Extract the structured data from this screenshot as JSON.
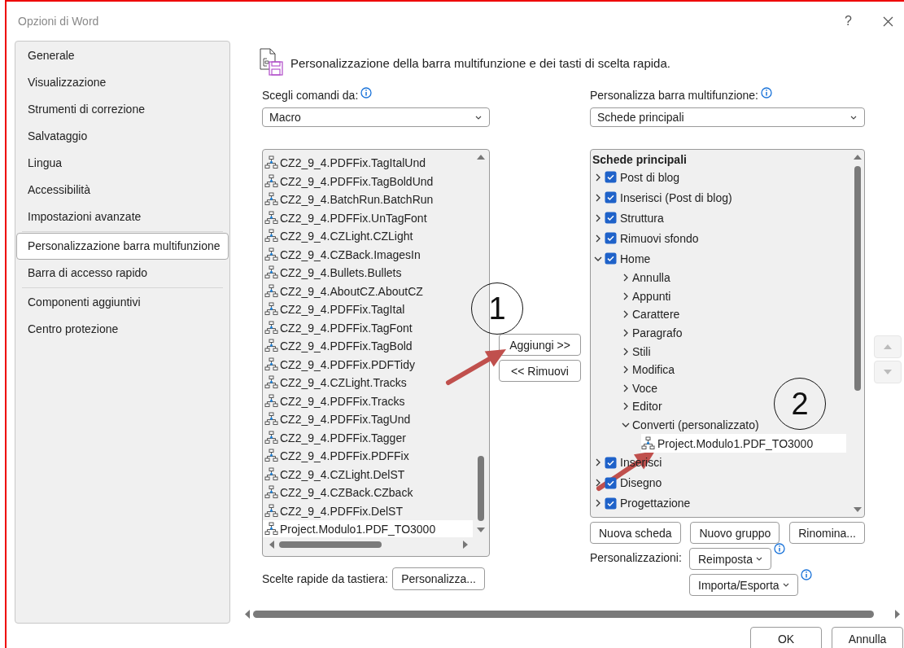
{
  "window": {
    "title": "Opzioni di Word",
    "help": "?"
  },
  "sidebar": {
    "groups": [
      [
        {
          "label": "Generale",
          "selected": false
        },
        {
          "label": "Visualizzazione",
          "selected": false
        },
        {
          "label": "Strumenti di correzione",
          "selected": false
        },
        {
          "label": "Salvataggio",
          "selected": false
        },
        {
          "label": "Lingua",
          "selected": false
        },
        {
          "label": "Accessibilità",
          "selected": false
        },
        {
          "label": "Impostazioni avanzate",
          "selected": false
        }
      ],
      [
        {
          "label": "Personalizzazione barra multifunzione",
          "selected": true
        },
        {
          "label": "Barra di accesso rapido",
          "selected": false
        }
      ],
      [
        {
          "label": "Componenti aggiuntivi",
          "selected": false
        },
        {
          "label": "Centro protezione",
          "selected": false
        }
      ]
    ]
  },
  "page_title": "Personalizzazione della barra multifunzione e dei tasti di scelta rapida.",
  "commands": {
    "label": "Scegli comandi da:",
    "dropdown": "Macro",
    "items": [
      {
        "label": "CZ2_9_4.PDFFix.TagItalUnd",
        "selected": false
      },
      {
        "label": "CZ2_9_4.PDFFix.TagBoldUnd",
        "selected": false
      },
      {
        "label": "CZ2_9_4.BatchRun.BatchRun",
        "selected": false
      },
      {
        "label": "CZ2_9_4.PDFFix.UnTagFont",
        "selected": false
      },
      {
        "label": "CZ2_9_4.CZLight.CZLight",
        "selected": false
      },
      {
        "label": "CZ2_9_4.CZBack.ImagesIn",
        "selected": false
      },
      {
        "label": "CZ2_9_4.Bullets.Bullets",
        "selected": false
      },
      {
        "label": "CZ2_9_4.AboutCZ.AboutCZ",
        "selected": false
      },
      {
        "label": "CZ2_9_4.PDFFix.TagItal",
        "selected": false
      },
      {
        "label": "CZ2_9_4.PDFFix.TagFont",
        "selected": false
      },
      {
        "label": "CZ2_9_4.PDFFix.TagBold",
        "selected": false
      },
      {
        "label": "CZ2_9_4.PDFFix.PDFTidy",
        "selected": false
      },
      {
        "label": "CZ2_9_4.CZLight.Tracks",
        "selected": false
      },
      {
        "label": "CZ2_9_4.PDFFix.Tracks",
        "selected": false
      },
      {
        "label": "CZ2_9_4.PDFFix.TagUnd",
        "selected": false
      },
      {
        "label": "CZ2_9_4.PDFFix.Tagger",
        "selected": false
      },
      {
        "label": "CZ2_9_4.PDFFix.PDFFix",
        "selected": false
      },
      {
        "label": "CZ2_9_4.CZLight.DelST",
        "selected": false
      },
      {
        "label": "CZ2_9_4.CZBack.CZback",
        "selected": false
      },
      {
        "label": "CZ2_9_4.PDFFix.DelST",
        "selected": false
      },
      {
        "label": "Project.Modulo1.PDF_TO3000",
        "selected": true
      }
    ],
    "shortcuts_label": "Scelte rapide da tastiera:",
    "shortcuts_button": "Personalizza..."
  },
  "transfer_buttons": [
    "Aggiungi >>",
    "<< Rimuovi"
  ],
  "ribbon": {
    "label": "Personalizza barra multifunzione:",
    "dropdown": "Schede principali",
    "heading": "Schede principali",
    "items": [
      {
        "kind": "tab",
        "label": "Post di blog",
        "checked": true,
        "expanded": false,
        "selected": false
      },
      {
        "kind": "tab",
        "label": "Inserisci (Post di blog)",
        "checked": true,
        "expanded": false,
        "selected": false
      },
      {
        "kind": "tab",
        "label": "Struttura",
        "checked": true,
        "expanded": false,
        "selected": false
      },
      {
        "kind": "tab",
        "label": "Rimuovi sfondo",
        "checked": true,
        "expanded": false,
        "selected": false
      },
      {
        "kind": "tab",
        "label": "Home",
        "checked": true,
        "expanded": true,
        "selected": false,
        "children": [
          {
            "kind": "group",
            "label": "Annulla",
            "expanded": false,
            "selected": false
          },
          {
            "kind": "group",
            "label": "Appunti",
            "expanded": false,
            "selected": false
          },
          {
            "kind": "group",
            "label": "Carattere",
            "expanded": false,
            "selected": false
          },
          {
            "kind": "group",
            "label": "Paragrafo",
            "expanded": false,
            "selected": false
          },
          {
            "kind": "group",
            "label": "Stili",
            "expanded": false,
            "selected": false
          },
          {
            "kind": "group",
            "label": "Modifica",
            "expanded": false,
            "selected": false
          },
          {
            "kind": "group",
            "label": "Voce",
            "expanded": false,
            "selected": false
          },
          {
            "kind": "group",
            "label": "Editor",
            "expanded": false,
            "selected": false
          },
          {
            "kind": "group",
            "label": "Converti (personalizzato)",
            "expanded": true,
            "selected": false,
            "children": [
              {
                "kind": "command",
                "label": "Project.Modulo1.PDF_TO3000",
                "selected": true
              }
            ]
          }
        ]
      },
      {
        "kind": "tab",
        "label": "Inserisci",
        "checked": true,
        "expanded": false,
        "selected": false
      },
      {
        "kind": "tab",
        "label": "Disegno",
        "checked": true,
        "expanded": false,
        "selected": false
      },
      {
        "kind": "tab",
        "label": "Progettazione",
        "checked": true,
        "expanded": false,
        "selected": false
      }
    ],
    "buttons": [
      "Nuova scheda",
      "Nuovo gruppo",
      "Rinomina..."
    ],
    "customizations_label": "Personalizzazioni:",
    "reset_button": "Reimposta",
    "import_export_button": "Importa/Esporta"
  },
  "dialog_buttons": [
    "OK",
    "Annulla"
  ],
  "annotations": [
    {
      "kind": "callout",
      "text": "1"
    },
    {
      "kind": "arrow"
    },
    {
      "kind": "callout",
      "text": "2"
    },
    {
      "kind": "arrow"
    }
  ]
}
